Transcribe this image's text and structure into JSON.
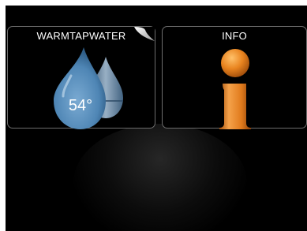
{
  "tiles": [
    {
      "title": "WARMTAPWATER",
      "value": "54°",
      "icon": "water-drop-icon",
      "accent": "#4f86b5"
    },
    {
      "title": "INFO",
      "icon": "info-icon",
      "accent": "#e07a1c"
    }
  ],
  "colors": {
    "background": "#000000",
    "tile_border": "#6e6e6e",
    "text": "#ffffff"
  }
}
